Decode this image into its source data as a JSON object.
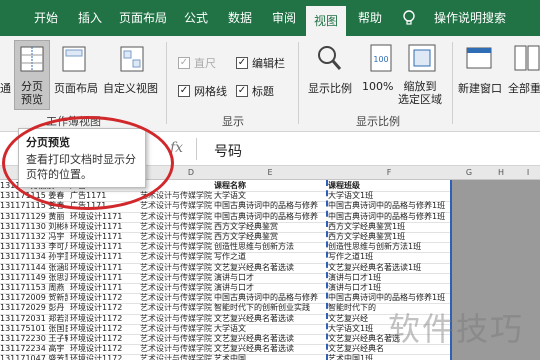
{
  "tabs": [
    {
      "label": "开始"
    },
    {
      "label": "插入"
    },
    {
      "label": "页面布局"
    },
    {
      "label": "公式"
    },
    {
      "label": "数据"
    },
    {
      "label": "审阅"
    },
    {
      "label": "视图"
    },
    {
      "label": "帮助"
    },
    {
      "label": "操作说明搜索"
    }
  ],
  "ribbon": {
    "cut_label": "通",
    "page_break_preview": "分页\n预览",
    "page_layout": "页面布局",
    "custom_view": "自定义视图",
    "group_workbook_views": "工作簿视图",
    "ruler": "直尺",
    "edit_bar": "编辑栏",
    "gridlines": "网格线",
    "headings": "标题",
    "group_show": "显示",
    "zoom": "显示比例",
    "zoom_100": "100%",
    "zoom_selection": "缩放到\n选定区域",
    "group_zoom": "显示比例",
    "new_window": "新建窗口",
    "arrange_all": "全部重"
  },
  "checkboxes": {
    "ruler_checked": true,
    "ruler_disabled": true,
    "edit_bar_checked": true,
    "gridlines_checked": true,
    "headings_checked": true
  },
  "formula_bar": {
    "fx": "fx",
    "content": "号码"
  },
  "tooltip": {
    "title": "分页预览",
    "body": "查看打印文档时显示分页符的位置。"
  },
  "columns": [
    "D",
    "E",
    "F",
    "G",
    "H",
    "I"
  ],
  "rows": [
    {
      "a": "131171方丽晨",
      "b": "广告1171",
      "c": "",
      "d": "课程名称",
      "e": "课程班级"
    },
    {
      "a": "131171115 姜春",
      "b": "广告1171",
      "c": "艺术设计与传媒学院",
      "d": "大学语文",
      "e": "大学语文1班"
    },
    {
      "a": "131171115 姜春",
      "b": "广告1171",
      "c": "艺术设计与传媒学院",
      "d": "中国古典诗词中的品格与修养",
      "e": "中国古典诗词中的品格与修养1班"
    },
    {
      "a": "131171129 黄丽",
      "b": "环境设计1171",
      "c": "艺术设计与传媒学院",
      "d": "中国古典诗词中的品格与修养",
      "e": "中国古典诗词中的品格与修养1班"
    },
    {
      "a": "131171130 刘彬彬",
      "b": "环境设计1171",
      "c": "艺术设计与传媒学院",
      "d": "西方文学经典鉴赏",
      "e": "西方文学经典鉴赏1班"
    },
    {
      "a": "131171132 冯宇",
      "b": "环境设计1171",
      "c": "艺术设计与传媒学院",
      "d": "西方文学经典鉴赏",
      "e": "西方文学经典鉴赏1班"
    },
    {
      "a": "131171133 李可凡",
      "b": "环境设计1171",
      "c": "艺术设计与传媒学院",
      "d": "创造性思维与创新方法",
      "e": "创造性思维与创新方法1班"
    },
    {
      "a": "131171134 孙宇董",
      "b": "环境设计1171",
      "c": "艺术设计与传媒学院",
      "d": "写作之道",
      "e": "写作之道1班"
    },
    {
      "a": "131171144 张涵璐",
      "b": "环境设计1171",
      "c": "艺术设计与传媒学院",
      "d": "文艺复兴经典名著选读",
      "e": "文艺复兴经典名著选读1班"
    },
    {
      "a": "131171149 张思源",
      "b": "环境设计1171",
      "c": "艺术设计与传媒学院",
      "d": "演讲与口才",
      "e": "演讲与口才1班"
    },
    {
      "a": "131171153 周燕",
      "b": "环境设计1171",
      "c": "艺术设计与传媒学院",
      "d": "演讲与口才",
      "e": "演讲与口才1班"
    },
    {
      "a": "131172009 贺新凯",
      "b": "环境设计1172",
      "c": "艺术设计与传媒学院",
      "d": "中国古典诗词中的品格与修养",
      "e": "中国古典诗词中的品格与修养1班"
    },
    {
      "a": "131172029 彭丹",
      "b": "环境设计1172",
      "c": "艺术设计与传媒学院",
      "d": "智能时代下的创新创业实践",
      "e": "智能时代下的"
    },
    {
      "a": "131172031 郑若潮",
      "b": "环境设计1172",
      "c": "艺术设计与传媒学院",
      "d": "文艺复兴经典名著选读",
      "e": "文艺复兴经"
    },
    {
      "a": "131175101 张国良",
      "b": "环境设计1172",
      "c": "艺术设计与传媒学院",
      "d": "大学语文",
      "e": "大学语文1班"
    },
    {
      "a": "131172230 王子轩",
      "b": "环境设计1172",
      "c": "艺术设计与传媒学院",
      "d": "文艺复兴经典名著选读",
      "e": "文艺复兴经典名著选"
    },
    {
      "a": "131172234 高宇",
      "b": "环境设计1172",
      "c": "艺术设计与传媒学院",
      "d": "文艺复兴经典名著选读",
      "e": "文艺复兴经典名"
    },
    {
      "a": "131171047 盛芳慧",
      "b": "环境设计1172",
      "c": "艺术设计与传媒学院",
      "d": "艺术中国",
      "e": "艺术中国1班"
    }
  ],
  "watermark": "软件技巧",
  "accent_color": "#217346"
}
